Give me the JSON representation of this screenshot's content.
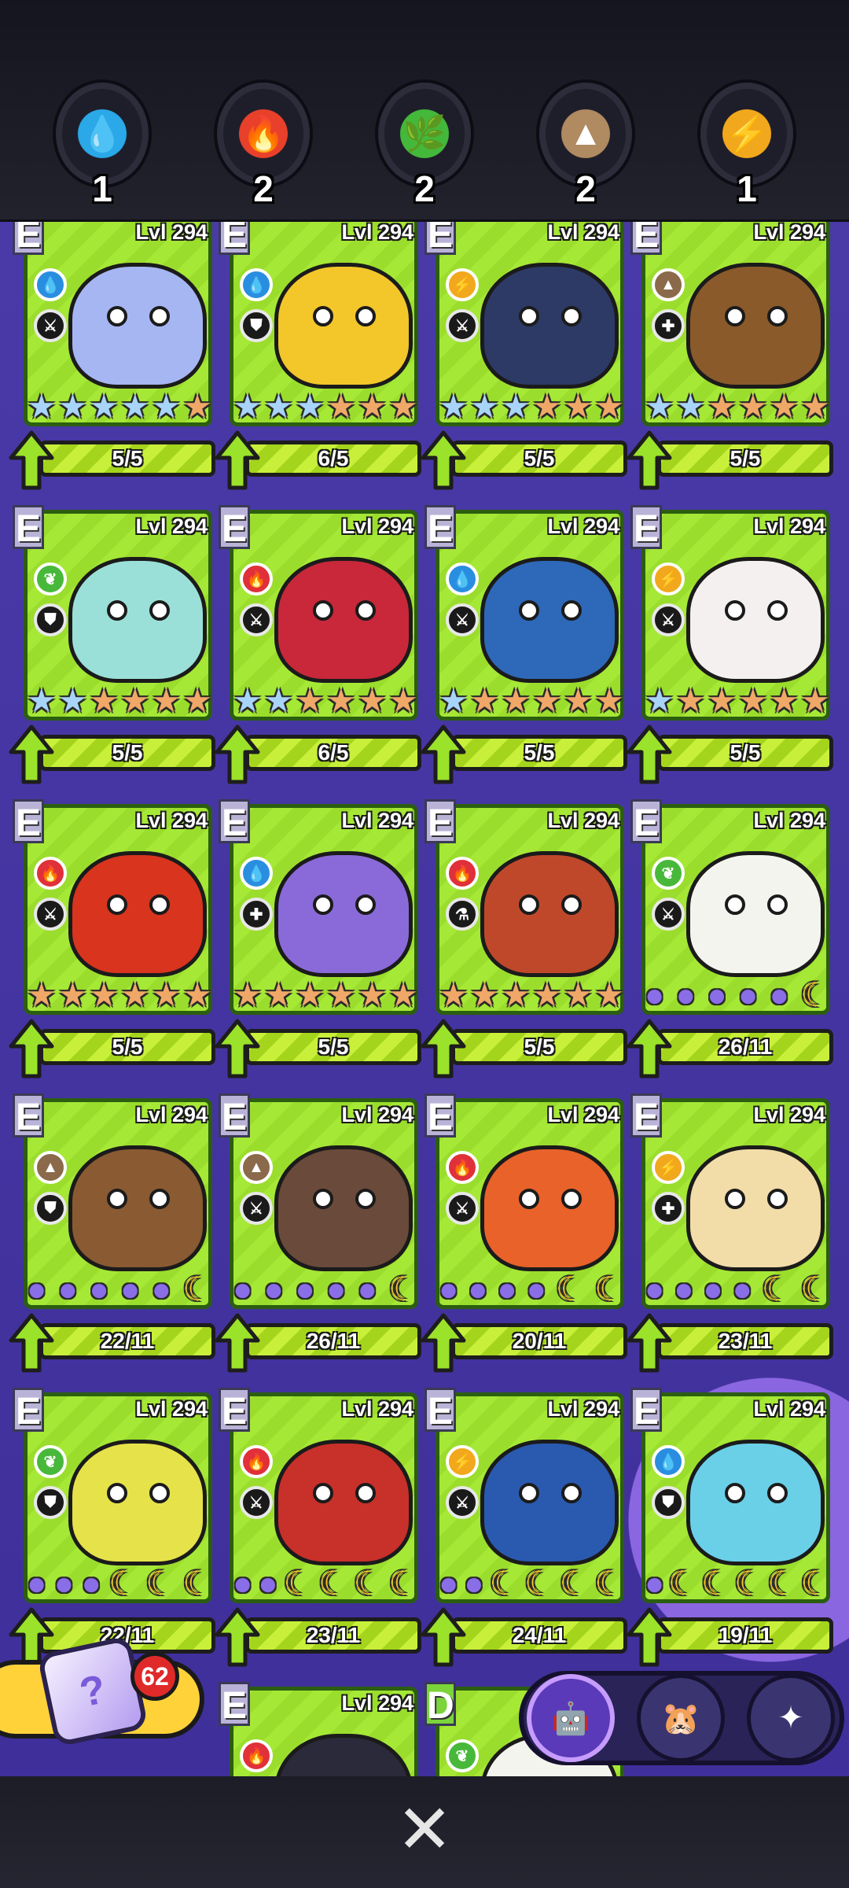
{
  "elements": [
    {
      "name": "water",
      "count": "1",
      "color": "#2aa8e8",
      "glyph": "💧"
    },
    {
      "name": "fire",
      "count": "2",
      "color": "#e8402a",
      "glyph": "🔥"
    },
    {
      "name": "nature",
      "count": "2",
      "color": "#44b83a",
      "glyph": "🌿"
    },
    {
      "name": "earth",
      "count": "2",
      "color": "#b08a60",
      "glyph": "▲"
    },
    {
      "name": "electric",
      "count": "1",
      "color": "#f2a81c",
      "glyph": "⚡"
    }
  ],
  "cards": [
    {
      "rank": "E",
      "level": "Lvl 294",
      "element": "water",
      "role": "attack",
      "body": "#a6b6f2",
      "stars": [
        "s",
        "s",
        "s",
        "s",
        "s",
        "b"
      ],
      "progress": "5/5"
    },
    {
      "rank": "E",
      "level": "Lvl 294",
      "element": "water",
      "role": "defense",
      "body": "#f3c62a",
      "stars": [
        "s",
        "s",
        "s",
        "b",
        "b",
        "b"
      ],
      "progress": "6/5"
    },
    {
      "rank": "E",
      "level": "Lvl 294",
      "element": "electric",
      "role": "attack",
      "body": "#2d3a66",
      "stars": [
        "s",
        "s",
        "s",
        "b",
        "b",
        "b"
      ],
      "progress": "5/5"
    },
    {
      "rank": "E",
      "level": "Lvl 294",
      "element": "earth",
      "role": "support",
      "body": "#8a5a2a",
      "stars": [
        "s",
        "s",
        "b",
        "b",
        "b",
        "b"
      ],
      "progress": "5/5"
    },
    {
      "rank": "E",
      "level": "Lvl 294",
      "element": "nature",
      "role": "defense",
      "body": "#9be0d8",
      "stars": [
        "s",
        "s",
        "b",
        "b",
        "b",
        "b"
      ],
      "progress": "5/5"
    },
    {
      "rank": "E",
      "level": "Lvl 294",
      "element": "fire",
      "role": "attack",
      "body": "#c8283a",
      "stars": [
        "s",
        "s",
        "b",
        "b",
        "b",
        "b"
      ],
      "progress": "6/5"
    },
    {
      "rank": "E",
      "level": "Lvl 294",
      "element": "water",
      "role": "attack",
      "body": "#2e68b8",
      "stars": [
        "s",
        "b",
        "b",
        "b",
        "b",
        "b"
      ],
      "progress": "5/5"
    },
    {
      "rank": "E",
      "level": "Lvl 294",
      "element": "electric",
      "role": "attack",
      "body": "#f4f0f0",
      "stars": [
        "s",
        "b",
        "b",
        "b",
        "b",
        "b"
      ],
      "progress": "5/5"
    },
    {
      "rank": "E",
      "level": "Lvl 294",
      "element": "fire",
      "role": "attack",
      "body": "#d8341e",
      "stars": [
        "b",
        "b",
        "b",
        "b",
        "b",
        "b"
      ],
      "progress": "5/5"
    },
    {
      "rank": "E",
      "level": "Lvl 294",
      "element": "water",
      "role": "support",
      "body": "#8a6ad8",
      "stars": [
        "b",
        "b",
        "b",
        "b",
        "b",
        "b"
      ],
      "progress": "5/5"
    },
    {
      "rank": "E",
      "level": "Lvl 294",
      "element": "fire",
      "role": "magic",
      "body": "#c0482a",
      "stars": [
        "b",
        "b",
        "b",
        "b",
        "b",
        "b"
      ],
      "progress": "5/5"
    },
    {
      "rank": "E",
      "level": "Lvl 294",
      "element": "nature",
      "role": "attack",
      "body": "#f4f4ee",
      "stars": [
        "m",
        "m",
        "m",
        "m",
        "m",
        "g"
      ],
      "progress": "26/11"
    },
    {
      "rank": "E",
      "level": "Lvl 294",
      "element": "earth",
      "role": "defense",
      "body": "#8a5a32",
      "stars": [
        "m",
        "m",
        "m",
        "m",
        "m",
        "g"
      ],
      "progress": "22/11"
    },
    {
      "rank": "E",
      "level": "Lvl 294",
      "element": "earth",
      "role": "attack",
      "body": "#6a4a3a",
      "stars": [
        "m",
        "m",
        "m",
        "m",
        "m",
        "g"
      ],
      "progress": "26/11"
    },
    {
      "rank": "E",
      "level": "Lvl 294",
      "element": "fire",
      "role": "attack",
      "body": "#e8622a",
      "stars": [
        "m",
        "m",
        "m",
        "m",
        "g",
        "g"
      ],
      "progress": "20/11"
    },
    {
      "rank": "E",
      "level": "Lvl 294",
      "element": "electric",
      "role": "support",
      "body": "#f2dca8",
      "stars": [
        "m",
        "m",
        "m",
        "m",
        "g",
        "g"
      ],
      "progress": "23/11"
    },
    {
      "rank": "E",
      "level": "Lvl 294",
      "element": "nature",
      "role": "defense",
      "body": "#e6e24a",
      "stars": [
        "m",
        "m",
        "m",
        "g",
        "g",
        "g"
      ],
      "progress": "22/11"
    },
    {
      "rank": "E",
      "level": "Lvl 294",
      "element": "fire",
      "role": "attack",
      "body": "#c8302a",
      "stars": [
        "m",
        "m",
        "g",
        "g",
        "g",
        "g"
      ],
      "progress": "23/11"
    },
    {
      "rank": "E",
      "level": "Lvl 294",
      "element": "electric",
      "role": "attack",
      "body": "#2a5ab0",
      "stars": [
        "m",
        "m",
        "g",
        "g",
        "g",
        "g"
      ],
      "progress": "24/11"
    },
    {
      "rank": "E",
      "level": "Lvl 294",
      "element": "water",
      "role": "defense",
      "body": "#6ad0e8",
      "stars": [
        "m",
        "g",
        "g",
        "g",
        "g",
        "g"
      ],
      "progress": "19/11"
    },
    {
      "rank": "",
      "level": "",
      "element": "",
      "role": "",
      "body": "",
      "stars": [],
      "progress": ""
    },
    {
      "rank": "E",
      "level": "Lvl 294",
      "element": "fire",
      "role": "",
      "body": "#2a2a3a",
      "stars": [],
      "progress": ""
    },
    {
      "rank": "D",
      "level": "",
      "element": "nature",
      "role": "",
      "body": "#f4f4ee",
      "stars": [],
      "progress": ""
    },
    {
      "rank": "",
      "level": "",
      "element": "",
      "role": "",
      "body": "",
      "stars": [],
      "progress": ""
    }
  ],
  "element_colors": {
    "water": "#2a8ee0",
    "fire": "#e0303a",
    "nature": "#48b83a",
    "earth": "#8a6a4a",
    "electric": "#f2a81c"
  },
  "element_glyphs": {
    "water": "💧",
    "fire": "🔥",
    "nature": "❦",
    "earth": "▲",
    "electric": "⚡"
  },
  "role_glyphs": {
    "attack": "⚔",
    "defense": "⛊",
    "support": "✚",
    "magic": "⚗"
  },
  "dice": {
    "count": "62",
    "glyph": "?"
  },
  "tabs": [
    {
      "name": "cat-robot-tab",
      "glyph": "🤖",
      "color": "#5a3ab8",
      "active": true
    },
    {
      "name": "pet-tab",
      "glyph": "🐹",
      "color": "#3a3470",
      "active": false
    },
    {
      "name": "star-cat-tab",
      "glyph": "✦",
      "color": "#3a3470",
      "active": false
    }
  ],
  "close_glyph": "✕"
}
